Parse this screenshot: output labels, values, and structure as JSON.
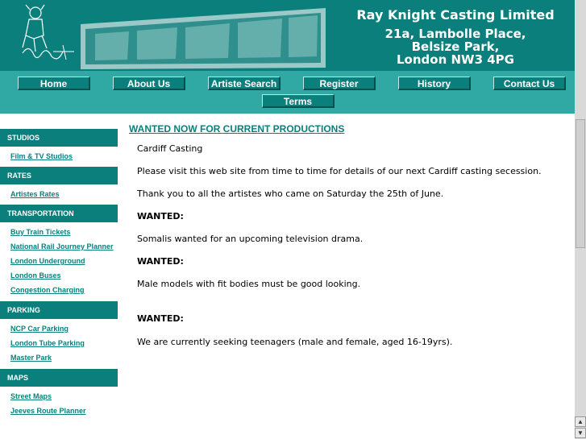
{
  "header": {
    "company": "Ray Knight Casting Limited",
    "address_line1": "21a, Lambolle Place,",
    "address_line2": "Belsize Park,",
    "address_line3": "London NW3 4PG",
    "colors": {
      "primary": "#0a7f7c",
      "band": "#30a8a4"
    }
  },
  "nav": {
    "home": "Home",
    "about": "About Us",
    "artiste_search": "Artiste Search",
    "register": "Register",
    "history": "History",
    "contact": "Contact Us",
    "terms": "Terms"
  },
  "sidebar": {
    "studios": {
      "heading": "STUDIOS",
      "links": [
        "Film & TV Studios"
      ]
    },
    "rates": {
      "heading": "RATES",
      "links": [
        "Artistes Rates"
      ]
    },
    "transportation": {
      "heading": "TRANSPORTATION",
      "links": [
        "Buy Train Tickets",
        "National Rail Journey Planner",
        "London Underground",
        "London Buses",
        "Congestion Charging"
      ]
    },
    "parking": {
      "heading": "PARKING",
      "links": [
        "NCP Car Parking",
        "London Tube Parking",
        "Master Park"
      ]
    },
    "maps": {
      "heading": "MAPS",
      "links": [
        "Street Maps",
        "Jeeves Route Planner"
      ]
    }
  },
  "content": {
    "title": "WANTED NOW FOR CURRENT PRODUCTIONS",
    "p1": "Cardiff Casting",
    "p2": "Please visit this web site from time to time for details of our next Cardiff casting secession.",
    "p3": "Thank you to all the artistes who came on Saturday the 25th of June.",
    "h1": "WANTED:",
    "p4": "Somalis wanted for an upcoming television drama.",
    "h2": "WANTED:",
    "p5": "Male models with fit bodies must be good looking.",
    "h3": "WANTED:",
    "p6": "We are currently seeking teenagers (male and female, aged 16-19yrs)."
  }
}
